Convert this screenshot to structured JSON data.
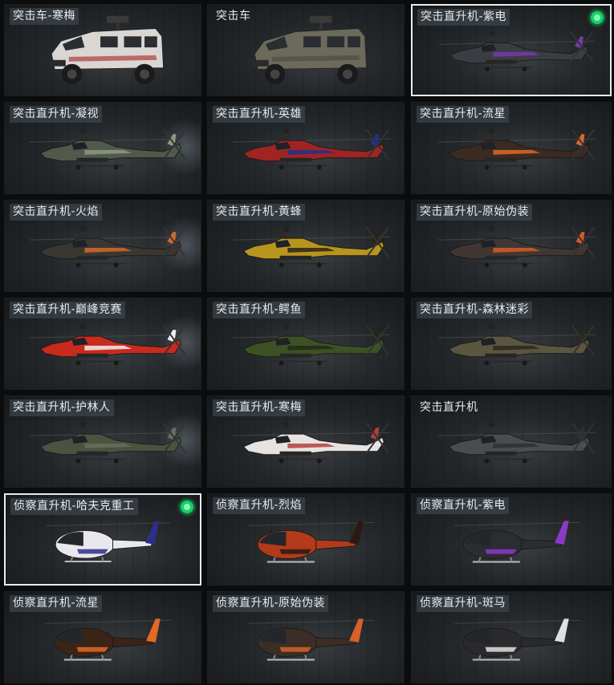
{
  "items": [
    {
      "label": "突击车-寒梅",
      "kind": "truck",
      "primary": "#d9d6d3",
      "accent": "#b23a3a",
      "selected": false,
      "equipped": false
    },
    {
      "label": "突击车",
      "kind": "truck",
      "primary": "#6b6a5b",
      "accent": "#4d4d42",
      "selected": false,
      "equipped": false,
      "plain": true
    },
    {
      "label": "突击直升机-紫电",
      "kind": "attack",
      "primary": "#3b3d45",
      "accent": "#7a3aa8",
      "selected": true,
      "equipped": true
    },
    {
      "label": "突击直升机-凝视",
      "kind": "attack",
      "primary": "#51594c",
      "accent": "#8d9a80",
      "selected": false,
      "equipped": false
    },
    {
      "label": "突击直升机-英雄",
      "kind": "attack",
      "primary": "#a02424",
      "accent": "#24308a",
      "selected": false,
      "equipped": false
    },
    {
      "label": "突击直升机-流星",
      "kind": "attack",
      "primary": "#3a2a22",
      "accent": "#e0662a",
      "selected": false,
      "equipped": false
    },
    {
      "label": "突击直升机-火焰",
      "kind": "attack",
      "primary": "#3a3632",
      "accent": "#d46a2a",
      "selected": false,
      "equipped": false
    },
    {
      "label": "突击直升机-黄蜂",
      "kind": "attack",
      "primary": "#b7951e",
      "accent": "#2a2416",
      "selected": false,
      "equipped": false
    },
    {
      "label": "突击直升机-原始伪装",
      "kind": "attack",
      "primary": "#403632",
      "accent": "#d65a2a",
      "selected": false,
      "equipped": false
    },
    {
      "label": "突击直升机-巅峰竞赛",
      "kind": "attack",
      "primary": "#c72b1e",
      "accent": "#f0f0f0",
      "selected": false,
      "equipped": false
    },
    {
      "label": "突击直升机-鳄鱼",
      "kind": "attack",
      "primary": "#3d5224",
      "accent": "#222a16",
      "selected": false,
      "equipped": false
    },
    {
      "label": "突击直升机-森林迷彩",
      "kind": "attack",
      "primary": "#5c5540",
      "accent": "#2b281d",
      "selected": false,
      "equipped": false
    },
    {
      "label": "突击直升机-护林人",
      "kind": "attack",
      "primary": "#4c5240",
      "accent": "#6a6e5a",
      "selected": false,
      "equipped": false
    },
    {
      "label": "突击直升机-寒梅",
      "kind": "attack",
      "primary": "#e6e3e0",
      "accent": "#b53d3d",
      "selected": false,
      "equipped": false
    },
    {
      "label": "突击直升机",
      "kind": "attack",
      "primary": "#4a4d50",
      "accent": "#2e3033",
      "selected": false,
      "equipped": false,
      "plain": true
    },
    {
      "label": "侦察直升机-哈夫克重工",
      "kind": "scout",
      "primary": "#e8e8ee",
      "accent": "#2e2f86",
      "selected": true,
      "equipped": true
    },
    {
      "label": "侦察直升机-烈焰",
      "kind": "scout",
      "primary": "#b33a1a",
      "accent": "#2a1a14",
      "selected": false,
      "equipped": false
    },
    {
      "label": "侦察直升机-紫电",
      "kind": "scout",
      "primary": "#2c2c33",
      "accent": "#8a3ac4",
      "selected": false,
      "equipped": false
    },
    {
      "label": "侦察直升机-流星",
      "kind": "scout",
      "primary": "#3a2418",
      "accent": "#e36a24",
      "selected": false,
      "equipped": false
    },
    {
      "label": "侦察直升机-原始伪装",
      "kind": "scout",
      "primary": "#3a2e26",
      "accent": "#d9602a",
      "selected": false,
      "equipped": false
    },
    {
      "label": "侦察直升机-斑马",
      "kind": "scout",
      "primary": "#2a2a2c",
      "accent": "#e0e0e0",
      "selected": false,
      "equipped": false
    }
  ]
}
